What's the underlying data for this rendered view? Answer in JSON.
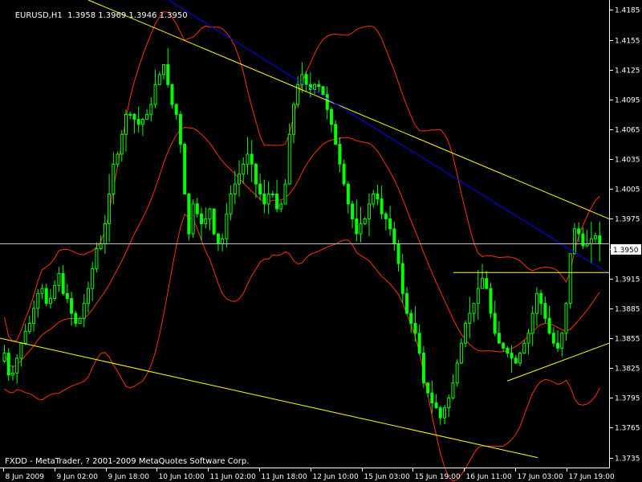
{
  "header": {
    "symbol": "EURUSD,H1",
    "ohlc": "1.3958 1.3969 1.3946 1.3950"
  },
  "footer": {
    "copyright": "FXDD - MetaTrader, ? 2001-2009 MetaQuotes Software Corp."
  },
  "colors": {
    "background": "#000000",
    "axis": "#ffffff",
    "candle": "#00ff00",
    "bands": "#ff3300",
    "trendline": "#ffff00",
    "channel": "#0000ff",
    "bid_line": "#c0c0c0"
  },
  "chart_data": {
    "type": "candlestick",
    "title": "EURUSD,H1",
    "y_axis": {
      "ticks": [
        "1.4185",
        "1.4155",
        "1.4125",
        "1.4095",
        "1.4065",
        "1.4035",
        "1.4005",
        "1.3975",
        "1.3945",
        "1.3915",
        "1.3885",
        "1.3855",
        "1.3825",
        "1.3795",
        "1.3765",
        "1.3735"
      ],
      "range": [
        1.3725,
        1.4195
      ],
      "position": "right"
    },
    "x_axis": {
      "ticks": [
        "8 Jun 2009",
        "9 Jun 02:00",
        "9 Jun 18:00",
        "10 Jun 10:00",
        "11 Jun 02:00",
        "11 Jun 18:00",
        "12 Jun 10:00",
        "15 Jun 03:00",
        "15 Jun 19:00",
        "16 Jun 11:00",
        "17 Jun 03:00",
        "17 Jun 19:00"
      ]
    },
    "bid_price": "1.3950",
    "series": [
      {
        "indicator": "bollinger_bands",
        "lines": [
          "upper",
          "middle",
          "lower"
        ]
      },
      {
        "indicator": "trendlines",
        "count": 5
      }
    ],
    "candles_close": [
      1.384,
      1.3818,
      1.382,
      1.3835,
      1.385,
      1.3862,
      1.387,
      1.3885,
      1.39,
      1.3905,
      1.389,
      1.3895,
      1.3908,
      1.392,
      1.39,
      1.3895,
      1.388,
      1.387,
      1.3875,
      1.389,
      1.3905,
      1.3925,
      1.3945,
      1.395,
      1.397,
      1.4,
      1.403,
      1.404,
      1.406,
      1.408,
      1.408,
      1.4075,
      1.407,
      1.4075,
      1.408,
      1.409,
      1.411,
      1.412,
      1.413,
      1.411,
      1.409,
      1.408,
      1.405,
      1.4,
      1.396,
      1.399,
      1.398,
      1.397,
      1.3975,
      1.3985,
      1.396,
      1.395,
      1.3955,
      1.398,
      1.4,
      1.401,
      1.402,
      1.403,
      1.404,
      1.403,
      1.401,
      1.4,
      1.399,
      1.4,
      1.4,
      1.3985,
      1.399,
      1.401,
      1.406,
      1.409,
      1.411,
      1.412,
      1.411,
      1.4105,
      1.411,
      1.4108,
      1.41,
      1.4085,
      1.407,
      1.405,
      1.403,
      1.401,
      1.399,
      1.3975,
      1.396,
      1.397,
      1.3975,
      1.399,
      1.4,
      1.3995,
      1.398,
      1.3975,
      1.3965,
      1.395,
      1.393,
      1.39,
      1.388,
      1.387,
      1.386,
      1.384,
      1.381,
      1.38,
      1.379,
      1.3785,
      1.3775,
      1.3785,
      1.3795,
      1.381,
      1.383,
      1.385,
      1.387,
      1.388,
      1.389,
      1.3905,
      1.3915,
      1.3905,
      1.388,
      1.386,
      1.385,
      1.3845,
      1.384,
      1.3835,
      1.383,
      1.384,
      1.385,
      1.386,
      1.388,
      1.39,
      1.389,
      1.3875,
      1.386,
      1.385,
      1.3845,
      1.386,
      1.389,
      1.394,
      1.3965,
      1.396,
      1.3948,
      1.395,
      1.3955,
      1.3958,
      1.395
    ]
  }
}
